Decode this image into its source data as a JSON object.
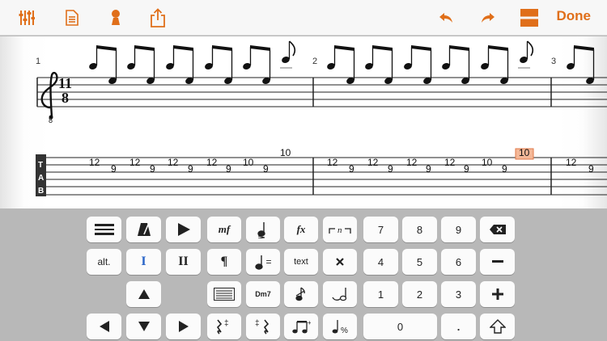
{
  "toolbar": {
    "done_label": "Done",
    "accent": "#e06f1a",
    "icons": [
      "mixer-icon",
      "document-icon",
      "pushpin-icon",
      "share-icon",
      "undo-icon",
      "redo-icon",
      "split-view-icon"
    ]
  },
  "score": {
    "time_signature": {
      "top": "11",
      "bottom": "8"
    },
    "clef": "treble-8vb",
    "measure_numbers": [
      "1",
      "2",
      "3"
    ],
    "tab_label": [
      "T",
      "A",
      "B"
    ],
    "measures": [
      {
        "tab_frets": [
          "12",
          "9",
          "12",
          "9",
          "12",
          "9",
          "12",
          "9",
          "10",
          "9",
          "10"
        ]
      },
      {
        "tab_frets": [
          "12",
          "9",
          "12",
          "9",
          "12",
          "9",
          "12",
          "9",
          "10",
          "9",
          "10"
        ]
      },
      {
        "tab_frets": [
          "12",
          "9"
        ]
      }
    ],
    "selected_note": "10",
    "selection_color": "#f4b898"
  },
  "keyboard": {
    "row1": [
      "mf",
      "fx",
      "7",
      "8",
      "9"
    ],
    "row2": [
      "alt.",
      "I",
      "II",
      "¶",
      "text",
      "4",
      "5",
      "6"
    ],
    "row3": [
      "Dm7",
      "1",
      "2",
      "3"
    ],
    "row4": [
      "0",
      "."
    ],
    "tempo_equals": "="
  }
}
